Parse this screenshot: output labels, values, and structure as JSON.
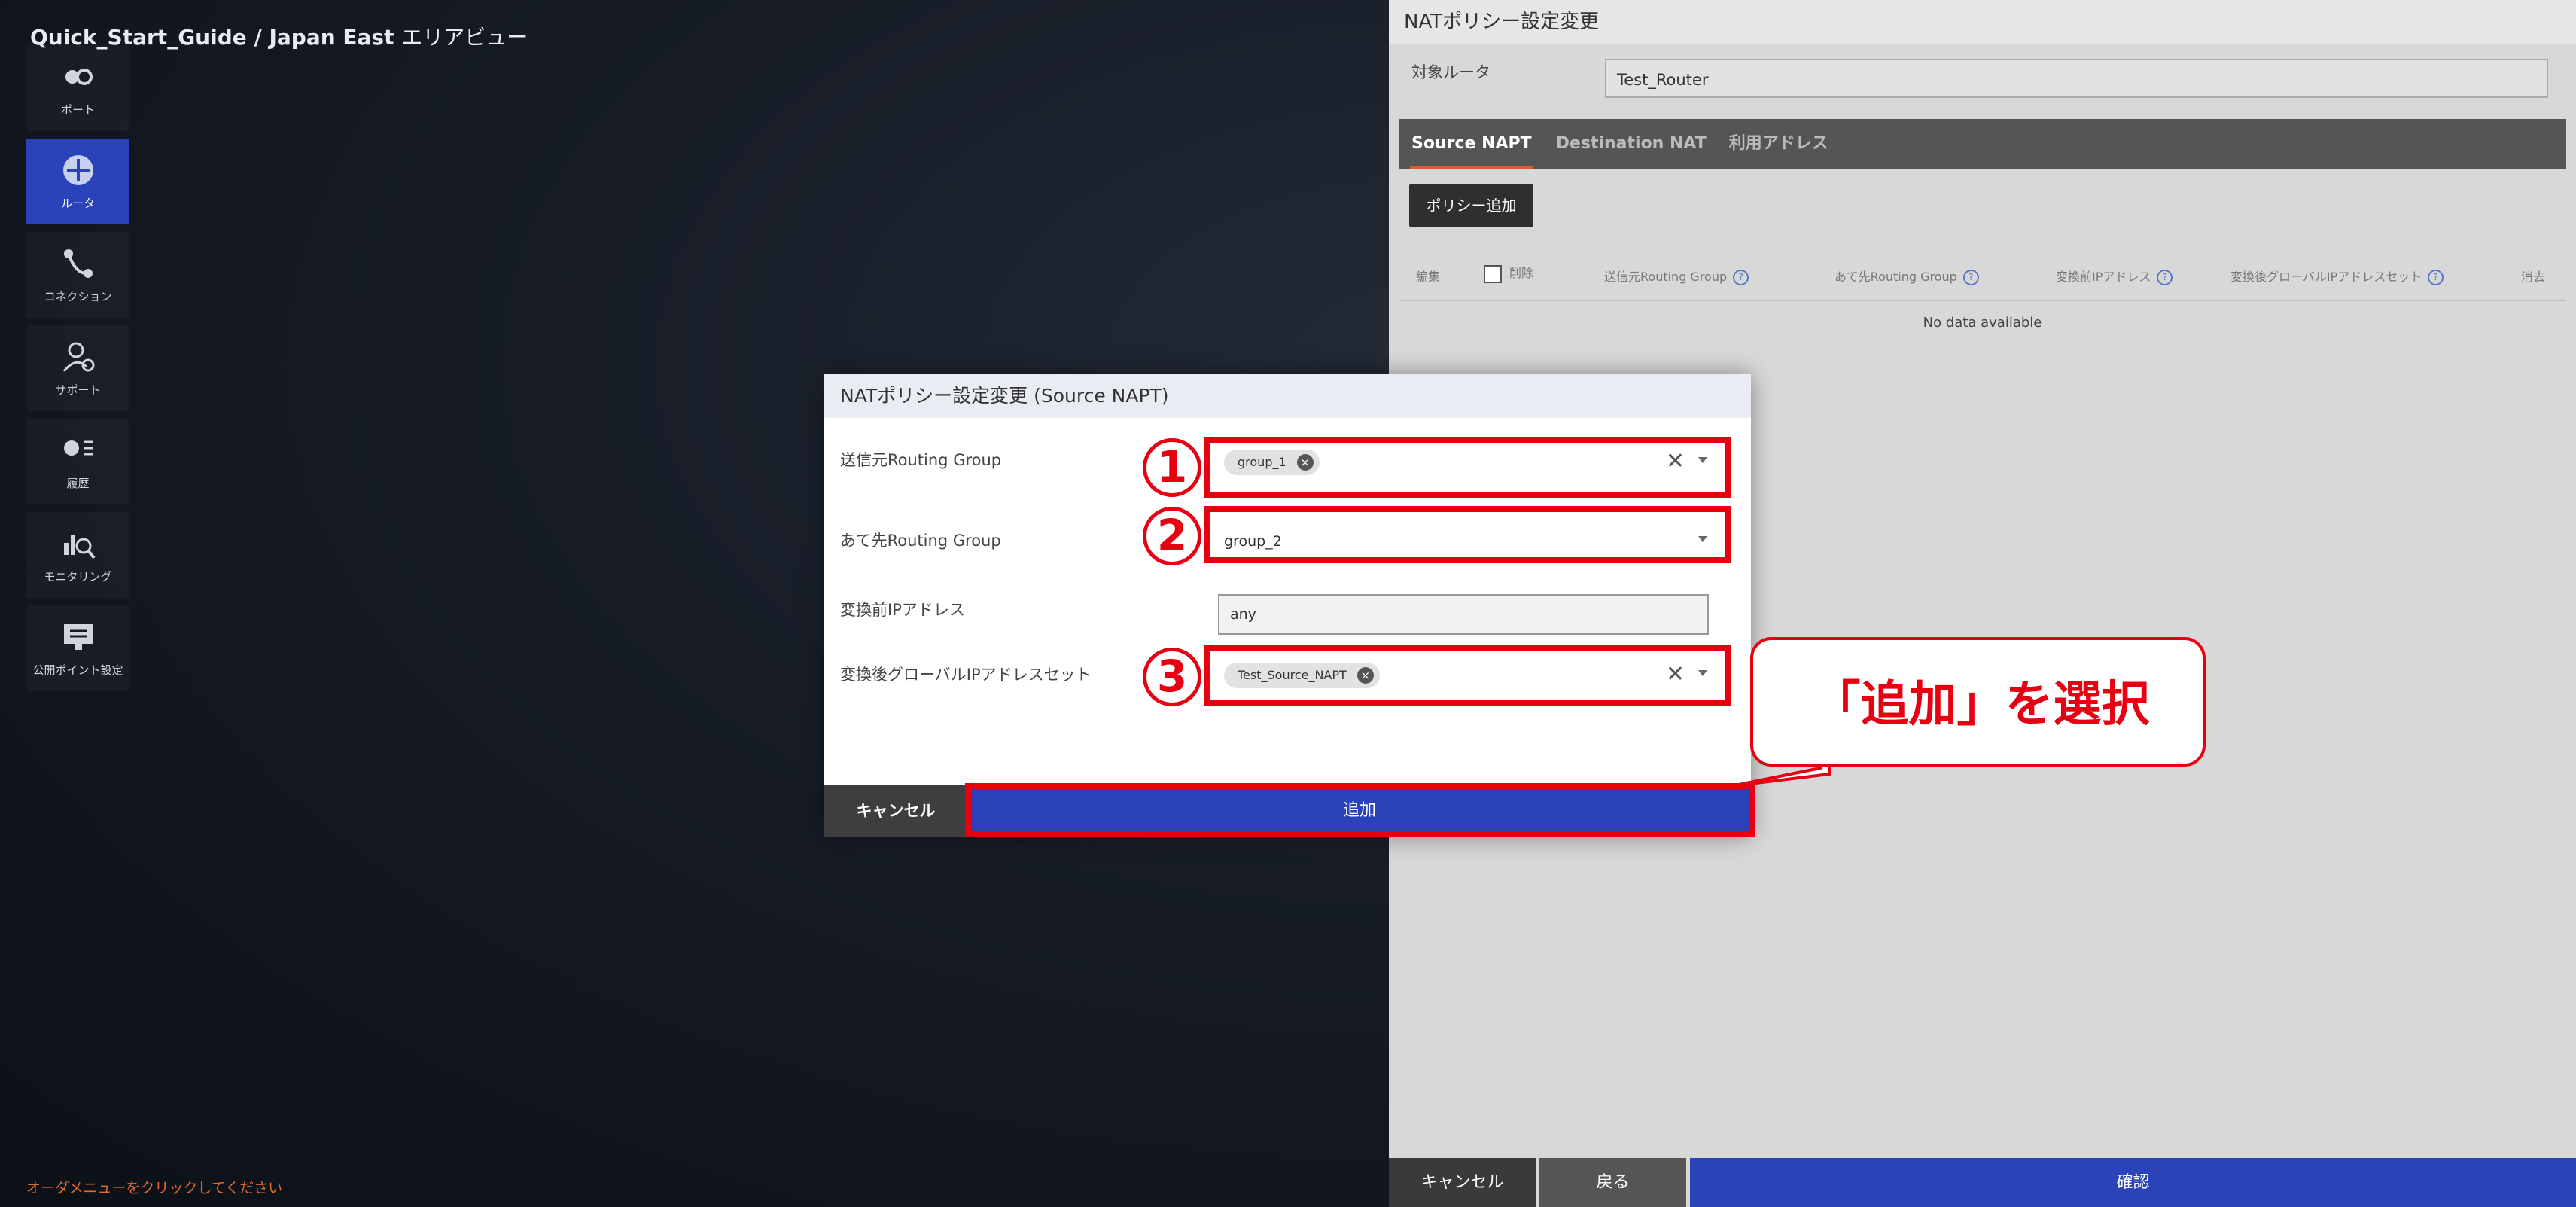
{
  "breadcrumb": {
    "project": "Quick_Start_Guide / Japan East",
    "view": "エリアビュー"
  },
  "sidebar": {
    "items": [
      {
        "label": "ポート",
        "icon": "port-icon"
      },
      {
        "label": "ルータ",
        "icon": "router-icon",
        "active": true
      },
      {
        "label": "コネクション",
        "icon": "connection-icon"
      },
      {
        "label": "サポート",
        "icon": "support-icon"
      },
      {
        "label": "履歴",
        "icon": "history-icon"
      },
      {
        "label": "モニタリング",
        "icon": "monitoring-icon"
      },
      {
        "label": "公開ポイント設定",
        "icon": "public-point-icon"
      }
    ],
    "order_hint": "オーダメニューをクリックしてください"
  },
  "panel": {
    "title": "NATポリシー設定変更",
    "router_label": "対象ルータ",
    "router_value": "Test_Router",
    "tabs": [
      "Source NAPT",
      "Destination NAT",
      "利用アドレス"
    ],
    "add_policy": "ポリシー追加",
    "table_headers": {
      "edit": "編集",
      "delete": "削除",
      "src_group": "送信元Routing Group",
      "dst_group": "あて先Routing Group",
      "pre_ip": "変換前IPアドレス",
      "post_ip": "変換後グローバルIPアドレスセット",
      "remove": "消去"
    },
    "empty": "No data available",
    "footer": {
      "cancel": "キャンセル",
      "back": "戻る",
      "confirm": "確認"
    }
  },
  "modal": {
    "title": "NATポリシー設定変更 (Source NAPT)",
    "fields": {
      "src_label": "送信元Routing Group",
      "src_chip": "group_1",
      "dst_label": "あて先Routing Group",
      "dst_value": "group_2",
      "pre_label": "変換前IPアドレス",
      "pre_value": "any",
      "post_label": "変換後グローバルIPアドレスセット",
      "post_chip": "Test_Source_NAPT"
    },
    "cancel": "キャンセル",
    "add": "追加"
  },
  "annotations": {
    "step1": "1",
    "step2": "2",
    "step3": "3",
    "callout": "「追加」を選択",
    "color": "#e60012"
  }
}
